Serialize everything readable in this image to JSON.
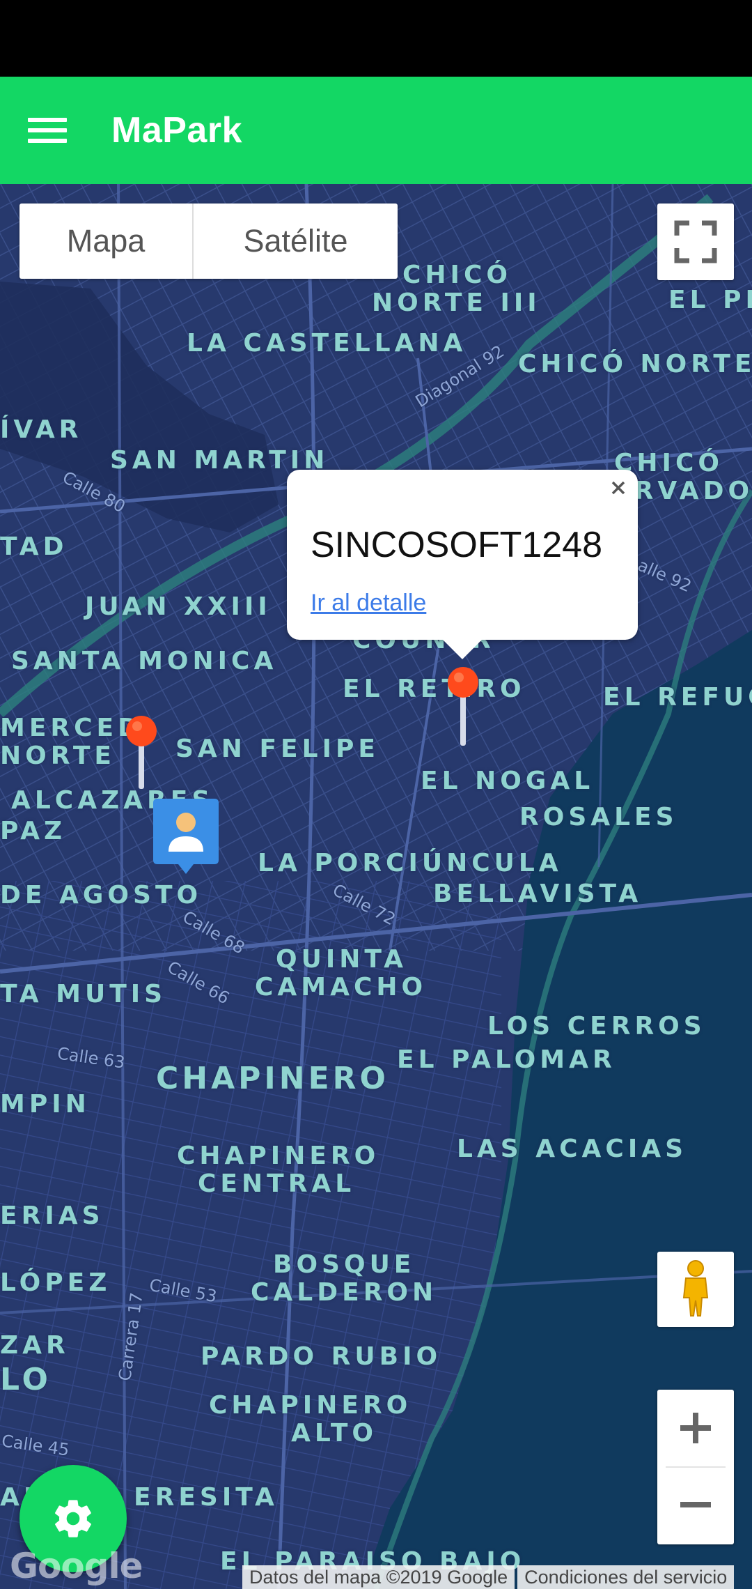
{
  "app": {
    "title": "MaPark",
    "accent": "#13d764"
  },
  "map": {
    "type_control": {
      "map_label": "Mapa",
      "satellite_label": "Satélite",
      "selected": "Mapa"
    },
    "neighborhoods": [
      "CHICÓ",
      "NORTE III",
      "EL PE",
      "LA CASTELLANA",
      "CHICÓ NORTE",
      "ÍVAR",
      "SAN MARTIN",
      "CHICÓ",
      "ERVADO",
      "TAD",
      "JUAN XXIII",
      "COUNTR",
      "SANTA MONICA",
      "EL RETIRO",
      "EL REFUG",
      "MERCED",
      "NORTE",
      "SAN FELIPE",
      "ALCAZARES",
      "PAZ",
      "EL NOGAL",
      "ROSALES",
      "LA PORCIÚNCULA",
      "DE AGOSTO",
      "BELLAVISTA",
      "QUINTA",
      "CAMACHO",
      "TA MUTIS",
      "LOS CERROS",
      "EL PALOMAR",
      "CHAPINERO",
      "MPIN",
      "CHAPINERO",
      "CENTRAL",
      "LAS ACACIAS",
      "ERIAS",
      "BOSQUE",
      "CALDERON",
      "LÓPEZ",
      "ZAR",
      "PARDO RUBIO",
      "LO",
      "CHAPINERO",
      "ALTO",
      "AN",
      "ERESITA",
      "EL PARAISO BAJO"
    ],
    "streets": [
      "Diagonal 92",
      "Calle 80",
      "alle 92",
      "Calle 72",
      "Calle 68",
      "Calle 66",
      "Calle 63",
      "Calle 53",
      "Carrera 17",
      "Calle 45"
    ],
    "info_window": {
      "title": "SINCOSOFT1248",
      "link": "Ir al detalle"
    },
    "attribution": {
      "data": "Datos del mapa ©2019 Google",
      "terms": "Condiciones del servicio"
    },
    "logo_text": "Google",
    "zoom_in": "+",
    "zoom_out": "−"
  }
}
